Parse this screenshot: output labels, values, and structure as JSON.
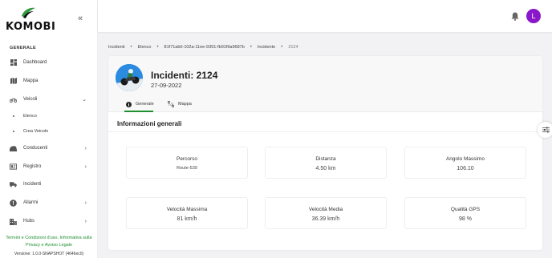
{
  "app": {
    "logo_text": "KOMOBI"
  },
  "sidebar": {
    "section_label": "GENERALE",
    "items": [
      {
        "label": "Dashboard",
        "icon": "dashboard-icon"
      },
      {
        "label": "Mappa",
        "icon": "map-icon"
      },
      {
        "label": "Veicoli",
        "icon": "motorcycle-icon",
        "expanded": true,
        "children": [
          {
            "label": "Elenco"
          },
          {
            "label": "Crea Veicolo"
          }
        ]
      },
      {
        "label": "Conducenti",
        "icon": "driver-icon"
      },
      {
        "label": "Registro",
        "icon": "register-icon"
      },
      {
        "label": "Incidenti",
        "icon": "truck-icon"
      },
      {
        "label": "Allarmi",
        "icon": "alarm-icon"
      },
      {
        "label": "Hubs",
        "icon": "building-icon"
      }
    ],
    "footer_line1": "Termini e Condizioni d'uso, Informativa sulla",
    "footer_line2": "Privacy e Avviso Legale",
    "version": "Versione: 1.0.0-SNAPSHOT (4646ec0)"
  },
  "topbar": {
    "avatar_letter": "L",
    "avatar_color": "#8a17c9"
  },
  "breadcrumb": [
    "Incidenti",
    "Elenco",
    "81f71ab0-102a-11ee-9391-fb91f9a9687b",
    "Incidente",
    "2124"
  ],
  "incident": {
    "title": "Incidenti: 2124",
    "date": "27-09-2022",
    "tabs": [
      {
        "label": "Generale",
        "active": true
      },
      {
        "label": "Mappa",
        "active": false
      }
    ]
  },
  "general_info": {
    "title": "Informazioni generali",
    "stats": [
      {
        "label": "Percorso",
        "value": "Route-539"
      },
      {
        "label": "Distanza",
        "value": "4.50 km"
      },
      {
        "label": "Angolo Massimo",
        "value": "106.10"
      },
      {
        "label": "Velocità Massima",
        "value": "81 km/h"
      },
      {
        "label": "Velocità Media",
        "value": "36.39 km/h"
      },
      {
        "label": "Qualità GPS",
        "value": "98 %"
      }
    ]
  },
  "colors": {
    "accent": "#1d8f2e",
    "avatar": "#8a17c9"
  }
}
